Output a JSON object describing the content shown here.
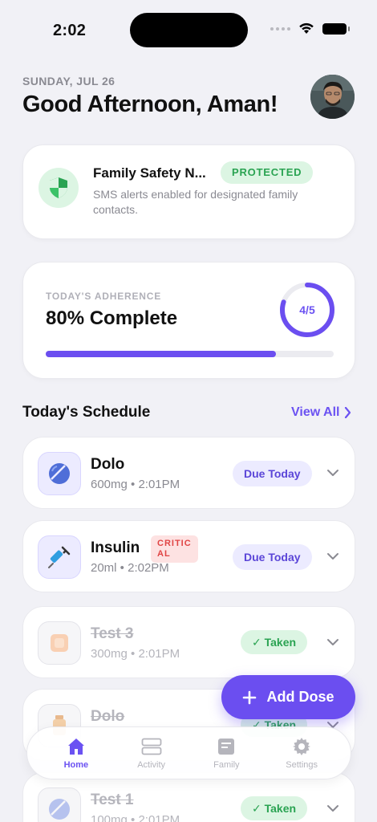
{
  "status_bar": {
    "time": "2:02"
  },
  "header": {
    "date": "SUNDAY, JUL 26",
    "greeting": "Good Afternoon, Aman!"
  },
  "safety": {
    "title": "Family Safety N...",
    "badge": "PROTECTED",
    "description": "SMS alerts enabled for designated family contacts."
  },
  "adherence": {
    "label": "TODAY'S ADHERENCE",
    "value": "80% Complete",
    "ring_text": "4/5",
    "fraction": 0.8
  },
  "schedule": {
    "title": "Today's Schedule",
    "view_all": "View All",
    "items": [
      {
        "name": "Dolo",
        "sub": "600mg • 2:01PM",
        "status": "Due Today",
        "taken": false
      },
      {
        "name": "Insulin",
        "sub": "20ml • 2:02PM",
        "status": "Due Today",
        "critical": "CRITIC AL",
        "taken": false
      },
      {
        "name": "Test 3",
        "sub": "300mg • 2:01PM",
        "status": "Taken",
        "taken": true
      },
      {
        "name": "Dolo",
        "sub": "",
        "status": "Taken",
        "taken": true
      },
      {
        "name": "Test 1",
        "sub": "100mg • 2:01PM",
        "status": "Taken",
        "taken": true
      }
    ]
  },
  "fab": {
    "label": "Add Dose"
  },
  "nav": {
    "items": [
      {
        "label": "Home",
        "icon": "home-icon",
        "active": true
      },
      {
        "label": "Activity",
        "icon": "list-icon",
        "active": false
      },
      {
        "label": "Family",
        "icon": "contact-card-icon",
        "active": false
      },
      {
        "label": "Settings",
        "icon": "gear-icon",
        "active": false
      }
    ]
  },
  "colors": {
    "accent": "#6b4ef0",
    "success": "#2aa352",
    "success_bg": "#dcf5e3",
    "danger": "#e04444",
    "background": "#f1f1f6"
  }
}
